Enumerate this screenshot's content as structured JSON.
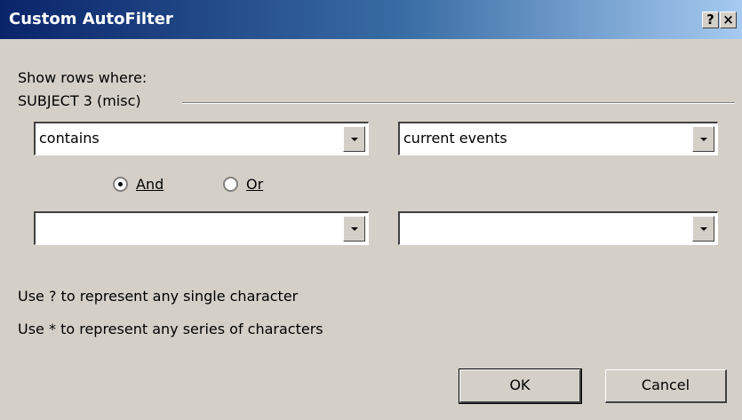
{
  "window": {
    "title": "Custom AutoFilter",
    "help_label": "?",
    "close_label": "×"
  },
  "filter": {
    "prompt": "Show rows where:",
    "field_name": "SUBJECT 3 (misc)",
    "row1": {
      "operator": "contains",
      "value": "current events"
    },
    "logic": {
      "and_label": "And",
      "or_label": "Or",
      "selected": "And"
    },
    "row2": {
      "operator": "",
      "value": ""
    }
  },
  "hints": {
    "single_char": "Use ? to represent any single character",
    "series_chars": "Use * to represent any series of characters"
  },
  "buttons": {
    "ok": "OK",
    "cancel": "Cancel"
  }
}
